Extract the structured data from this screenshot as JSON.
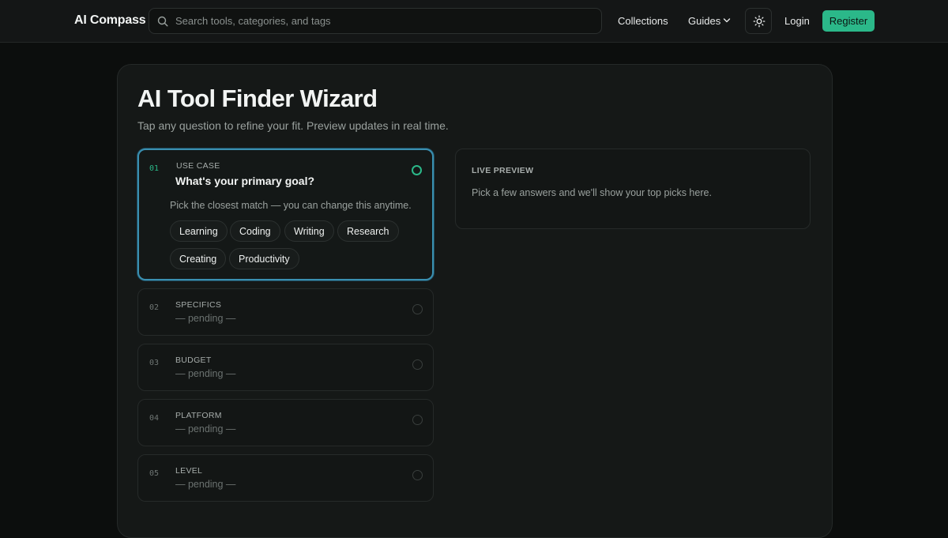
{
  "nav": {
    "brand": "AI Compass",
    "search_placeholder": "Search tools, categories, and tags",
    "collections": "Collections",
    "guides": "Guides",
    "login": "Login",
    "register": "Register",
    "accent_color": "#2bb889",
    "icons": [
      "search-icon",
      "chevron-down-icon",
      "sun-icon"
    ]
  },
  "page": {
    "title": "AI Tool Finder Wizard",
    "subtitle": "Tap any question to refine your fit. Preview updates in real time."
  },
  "steps": [
    {
      "num": "01",
      "label": "USE CASE",
      "question": "What's your primary goal?",
      "hint": "Pick the closest match — you can change this anytime.",
      "options": [
        "Learning",
        "Coding",
        "Writing",
        "Research",
        "Creating",
        "Productivity"
      ],
      "state": "active"
    },
    {
      "num": "02",
      "label": "SPECIFICS",
      "status": "— pending —"
    },
    {
      "num": "03",
      "label": "BUDGET",
      "status": "— pending —"
    },
    {
      "num": "04",
      "label": "PLATFORM",
      "status": "— pending —"
    },
    {
      "num": "05",
      "label": "LEVEL",
      "status": "— pending —"
    }
  ],
  "preview": {
    "label": "LIVE PREVIEW",
    "text": "Pick a few answers and we'll show your top picks here."
  }
}
